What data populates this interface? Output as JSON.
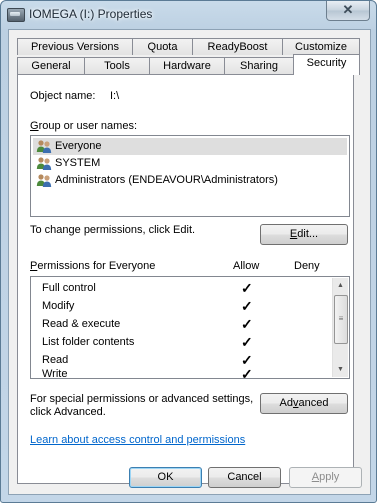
{
  "window": {
    "title": "IOMEGA (I:) Properties",
    "close_glyph": "✕"
  },
  "tabs_row1": [
    {
      "label": "Previous Versions"
    },
    {
      "label": "Quota"
    },
    {
      "label": "ReadyBoost"
    },
    {
      "label": "Customize"
    }
  ],
  "tabs_row2": [
    {
      "label": "General"
    },
    {
      "label": "Tools"
    },
    {
      "label": "Hardware"
    },
    {
      "label": "Sharing"
    },
    {
      "label": "Security",
      "active": true
    }
  ],
  "security": {
    "object_name_label": "Object name:",
    "object_name_value": "I:\\",
    "group_label_accel": "G",
    "group_label_rest": "roup or user names:",
    "users": [
      {
        "name": "Everyone",
        "selected": true
      },
      {
        "name": "SYSTEM"
      },
      {
        "name": "Administrators (ENDEAVOUR\\Administrators)"
      }
    ],
    "change_text": "To change permissions, click Edit.",
    "edit_button_accel": "E",
    "edit_button_rest": "dit...",
    "permissions_label_accel": "P",
    "permissions_label_rest": "ermissions for Everyone",
    "allow_header": "Allow",
    "deny_header": "Deny",
    "permissions": [
      {
        "name": "Full control",
        "allow": "✓",
        "deny": ""
      },
      {
        "name": "Modify",
        "allow": "✓",
        "deny": ""
      },
      {
        "name": "Read & execute",
        "allow": "✓",
        "deny": ""
      },
      {
        "name": "List folder contents",
        "allow": "✓",
        "deny": ""
      },
      {
        "name": "Read",
        "allow": "✓",
        "deny": ""
      },
      {
        "name": "Write",
        "allow": "✓",
        "deny": ""
      }
    ],
    "special_text_line1": "For special permissions or advanced settings,",
    "special_text_line2": "click Advanced.",
    "advanced_button_pre": "Ad",
    "advanced_button_accel": "v",
    "advanced_button_post": "anced",
    "learn_link": "Learn about access control and permissions"
  },
  "footer": {
    "ok_label": "OK",
    "cancel_label": "Cancel",
    "apply_accel": "A",
    "apply_rest": "pply"
  }
}
